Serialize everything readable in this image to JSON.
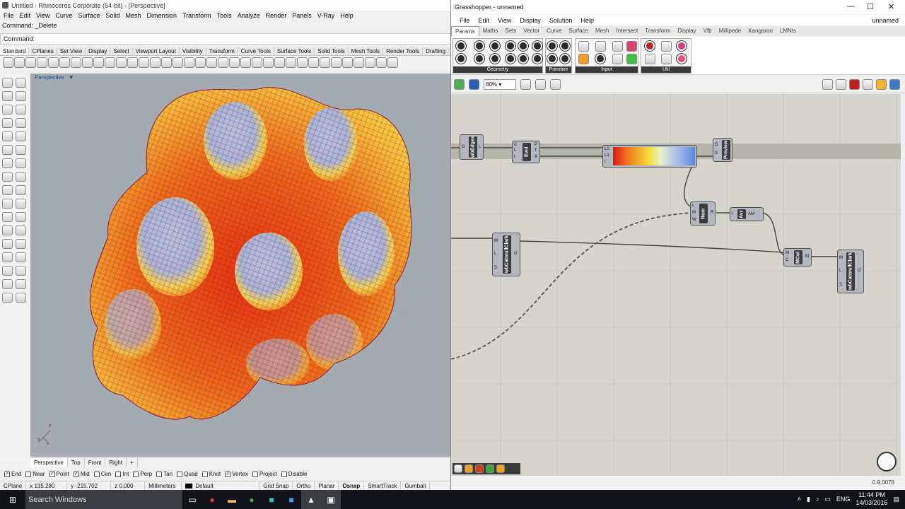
{
  "rhino": {
    "title": "Untitled - Rhinoceros Corporate (64-bit) - [Perspective]",
    "menu": [
      "File",
      "Edit",
      "View",
      "Curve",
      "Surface",
      "Solid",
      "Mesh",
      "Dimension",
      "Transform",
      "Tools",
      "Analyze",
      "Render",
      "Panels",
      "V-Ray",
      "Help"
    ],
    "command_history": "Command: _Delete",
    "command_prompt": "Command:",
    "toolbar_tabs": [
      "Standard",
      "CPlanes",
      "Set View",
      "Display",
      "Select",
      "Viewport Layout",
      "Visibility",
      "Transform",
      "Curve Tools",
      "Surface Tools",
      "Solid Tools",
      "Mesh Tools",
      "Render Tools",
      "Drafting"
    ],
    "viewport_label": "Perspective",
    "viewport_tabs": [
      "Perspective",
      "Top",
      "Front",
      "Right",
      "+"
    ],
    "osnaps": [
      {
        "label": "End",
        "checked": true
      },
      {
        "label": "Near",
        "checked": false
      },
      {
        "label": "Point",
        "checked": true
      },
      {
        "label": "Mid",
        "checked": true
      },
      {
        "label": "Cen",
        "checked": false
      },
      {
        "label": "Int",
        "checked": false
      },
      {
        "label": "Perp",
        "checked": false
      },
      {
        "label": "Tan",
        "checked": false
      },
      {
        "label": "Quad",
        "checked": false
      },
      {
        "label": "Knot",
        "checked": false
      },
      {
        "label": "Vertex",
        "checked": true
      },
      {
        "label": "Project",
        "checked": false
      },
      {
        "label": "Disable",
        "checked": false
      }
    ],
    "status": {
      "cplane": "CPlane",
      "x": "x 135.280",
      "y": "y -215.702",
      "z": "z 0.000",
      "units": "Millimeters",
      "layer": "Default",
      "grid_snap": "Grid Snap",
      "ortho": "Ortho",
      "planar": "Planar",
      "osnap": "Osnap",
      "smarttrack": "SmartTrack",
      "gumball": "Gumball"
    },
    "axis_labels": {
      "x": "x",
      "y": "y",
      "z": "z"
    }
  },
  "gh": {
    "title": "Grasshopper - unnamed",
    "doc_name": "unnamed",
    "menu": [
      "File",
      "Edit",
      "View",
      "Display",
      "Solution",
      "Help"
    ],
    "tabs": [
      "Params",
      "Maths",
      "Sets",
      "Vector",
      "Curve",
      "Surface",
      "Mesh",
      "Intersect",
      "Transform",
      "Display",
      "Vfb",
      "Millipede",
      "Kangaroo",
      "LMNts"
    ],
    "panels": [
      "Geometry",
      "Primitive",
      "Input",
      "Util"
    ],
    "zoom": "80%",
    "version": "0.9.0076",
    "components": {
      "wbEdges": "wbEdges",
      "eval": "Eval",
      "preview": "Preview",
      "rem": "Rem",
      "avr": "Avr",
      "mcol": "MCol",
      "catmull1": "wbCatmullClark",
      "catmull2": "wbCatmullClark"
    },
    "ports": {
      "wbEdges_in": "G",
      "wbEdges_out": "L",
      "eval_in": [
        "C",
        "L",
        "t"
      ],
      "eval_out": [
        "P",
        "T",
        "A"
      ],
      "grad_in": [
        "L0",
        "L1",
        "t"
      ],
      "preview_in": [
        "G",
        "S"
      ],
      "rem_in": [
        "L",
        "M",
        "W"
      ],
      "rem_out": "R",
      "avr_in": "I",
      "avr_out": "AM",
      "mcol_in": [
        "M",
        "C"
      ],
      "mcol_out": "M",
      "cat1_in": [
        "M",
        "L",
        "S"
      ],
      "cat1_out": "O",
      "cat2_in": [
        "M",
        "L",
        "S"
      ],
      "cat2_out": "O"
    }
  },
  "taskbar": {
    "search": "Search Windows",
    "lang": "ENG",
    "time": "11:44 PM",
    "date": "14/03/2016"
  },
  "colors": {
    "viewport_bg": "#a5aab0",
    "canvas_bg": "#d6d4cc",
    "surface_orange": "#ee6a1a",
    "surface_yellow": "#f5d43a",
    "surface_blue": "#a8b4d8",
    "mesh_line": "#7a1e3a"
  }
}
